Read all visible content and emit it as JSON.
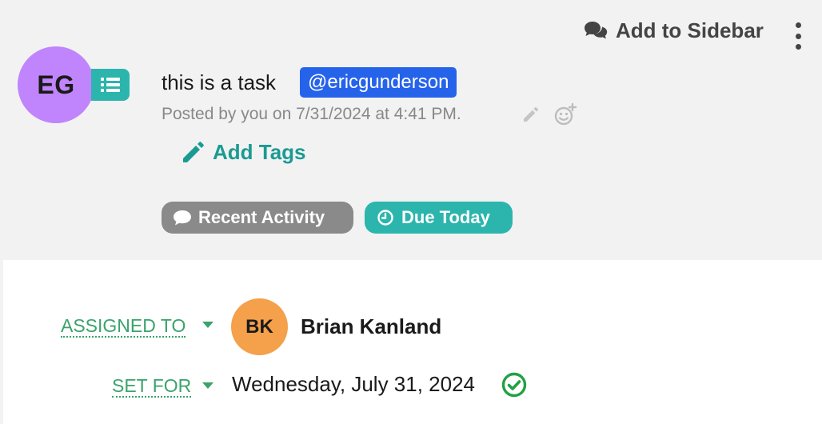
{
  "header": {
    "add_to_sidebar_label": "Add to Sidebar",
    "sidebar_icon": "chat-bubbles-icon",
    "menu_icon": "kebab-menu-icon"
  },
  "post": {
    "author_initials": "EG",
    "author_avatar_color": "#c084fc",
    "type_icon": "task-list-icon",
    "title": "this is a task",
    "mention": "@ericgunderson",
    "posted_text": "Posted by you on 7/31/2024 at 4:41 PM.",
    "add_tags_label": "Add Tags"
  },
  "chips": {
    "recent_activity": "Recent Activity",
    "due_today": "Due Today"
  },
  "details": {
    "assigned_to_label": "ASSIGNED TO",
    "assignee_initials": "BK",
    "assignee_avatar_color": "#f5a04a",
    "assignee_name": "Brian Kanland",
    "set_for_label": "SET FOR",
    "set_for_value": "Wednesday, July 31, 2024",
    "status_icon": "check-circle-icon"
  },
  "colors": {
    "teal": "#2bb5ad",
    "mention_blue": "#2563eb",
    "label_green": "#3aa36b",
    "gray_chip": "#8a8a8a"
  }
}
